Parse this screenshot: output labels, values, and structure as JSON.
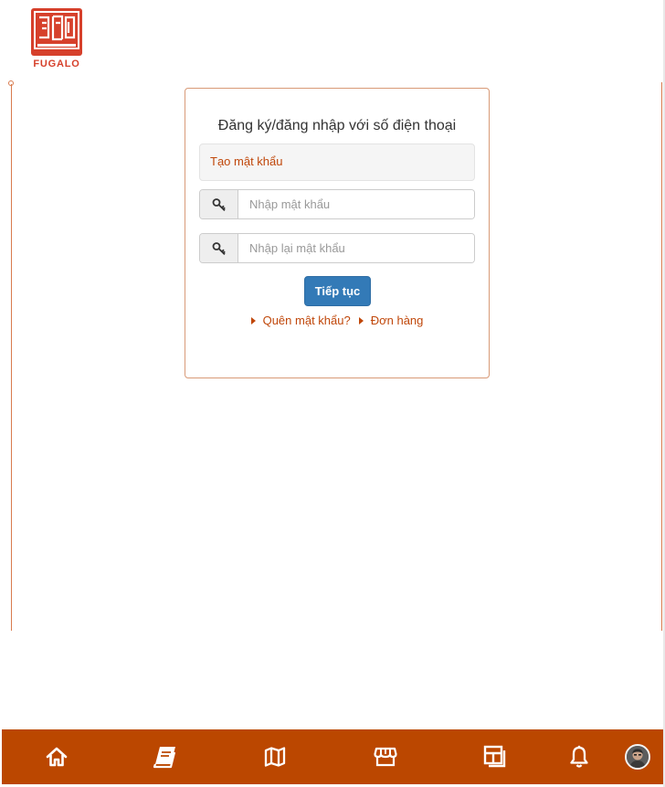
{
  "brand": {
    "name": "FUGALO",
    "color": "#d6402b"
  },
  "form": {
    "title": "Đăng ký/đăng nhập với số điện thoại",
    "notice": "Tạo mật khẩu",
    "password_placeholder": "Nhập mật khẩu",
    "confirm_password_placeholder": "Nhập lại mật khẩu",
    "submit_label": "Tiếp tục",
    "links": [
      {
        "label": "Quên mật khẩu?"
      },
      {
        "label": "Đơn hàng"
      }
    ]
  },
  "bottom_nav": {
    "background": "#bb4700",
    "items": [
      {
        "icon": "home-icon"
      },
      {
        "icon": "book-icon"
      },
      {
        "icon": "map-icon"
      },
      {
        "icon": "store-icon"
      },
      {
        "icon": "layout-icon"
      },
      {
        "icon": "bell-icon"
      },
      {
        "icon": "avatar"
      }
    ]
  },
  "colors": {
    "accent": "#c0470a",
    "button": "#337ab7"
  }
}
